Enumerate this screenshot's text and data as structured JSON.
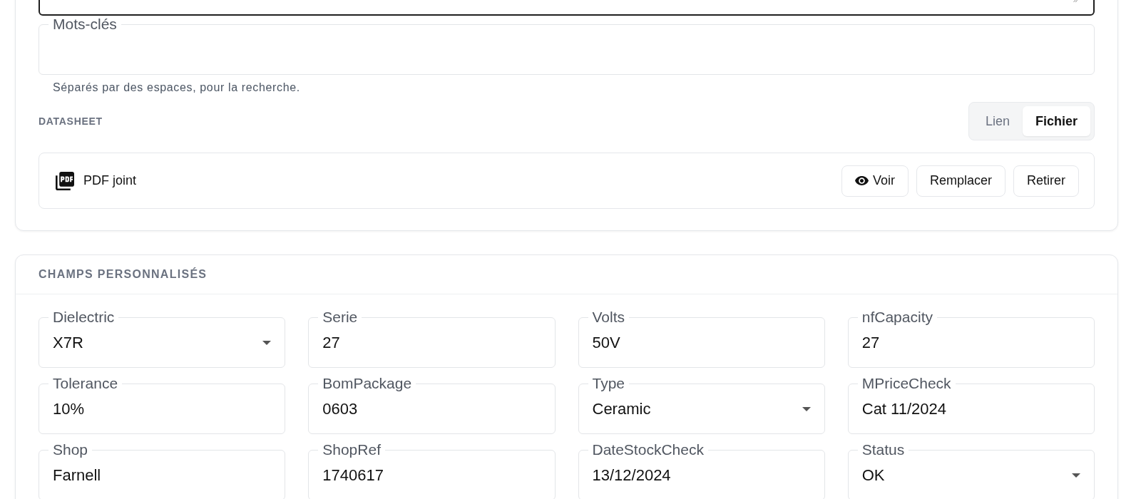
{
  "top_field": {
    "focused": true
  },
  "keywords": {
    "label": "Mots-clés",
    "helper": "Séparés par des espaces, pour la recherche."
  },
  "datasheet": {
    "title": "DATASHEET",
    "modes": [
      {
        "label": "Lien",
        "selected": false
      },
      {
        "label": "Fichier",
        "selected": true
      }
    ],
    "attachment": {
      "label": "PDF joint",
      "actions": [
        {
          "label": "Voir",
          "kind": "view"
        },
        {
          "label": "Remplacer",
          "kind": "plain"
        },
        {
          "label": "Retirer",
          "kind": "plain"
        }
      ]
    }
  },
  "custom_fields": {
    "title": "CHAMPS PERSONNALISÉS",
    "fields": [
      {
        "label": "Dielectric",
        "value": "X7R",
        "kind": "select"
      },
      {
        "label": "Serie",
        "value": "27",
        "kind": "text"
      },
      {
        "label": "Volts",
        "value": "50V",
        "kind": "text"
      },
      {
        "label": "nfCapacity",
        "value": "27",
        "kind": "text"
      },
      {
        "label": "Tolerance",
        "value": "10%",
        "kind": "text"
      },
      {
        "label": "BomPackage",
        "value": "0603",
        "kind": "text"
      },
      {
        "label": "Type",
        "value": "Ceramic",
        "kind": "select"
      },
      {
        "label": "MPriceCheck",
        "value": "Cat 11/2024",
        "kind": "text"
      },
      {
        "label": "Shop",
        "value": "Farnell",
        "kind": "text"
      },
      {
        "label": "ShopRef",
        "value": "1740617",
        "kind": "text"
      },
      {
        "label": "DateStockCheck",
        "value": "13/12/2024",
        "kind": "text"
      },
      {
        "label": "Status",
        "value": "OK",
        "kind": "select"
      }
    ]
  }
}
